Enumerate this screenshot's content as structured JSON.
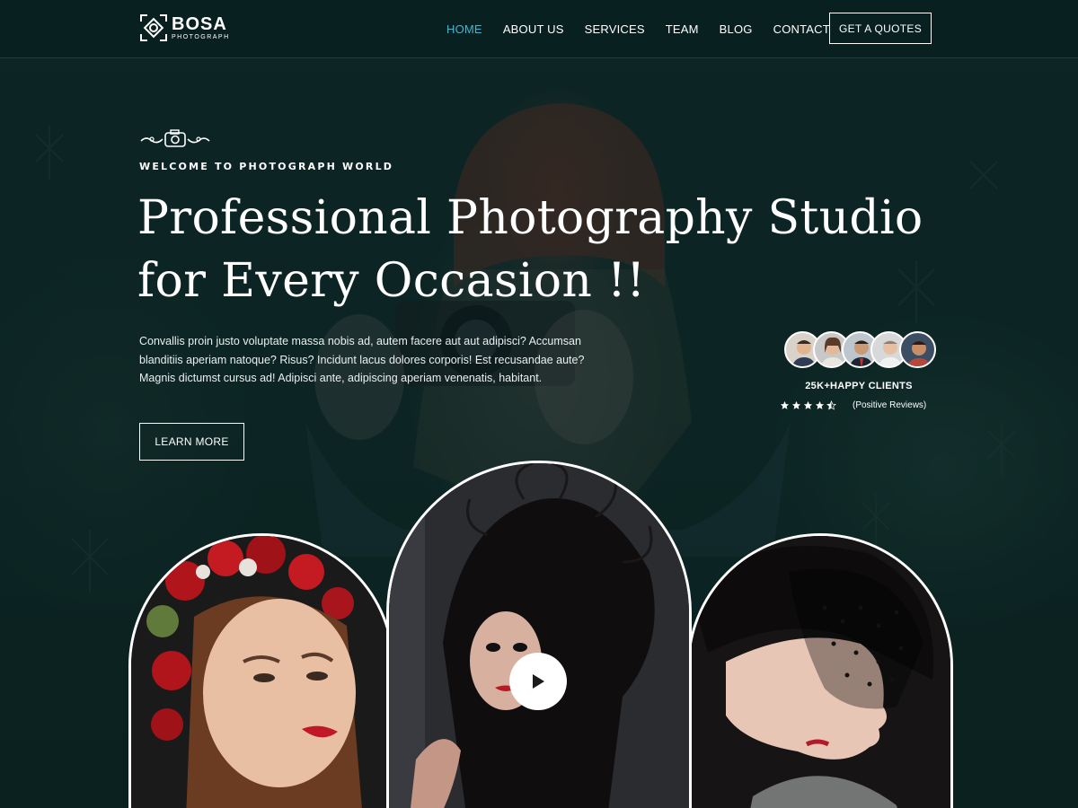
{
  "brand": {
    "name": "BOSA",
    "tagline": "PHOTOGRAPH"
  },
  "nav": {
    "items": [
      {
        "label": "HOME",
        "active": true
      },
      {
        "label": "ABOUT US",
        "active": false
      },
      {
        "label": "SERVICES",
        "active": false
      },
      {
        "label": "TEAM",
        "active": false
      },
      {
        "label": "BLOG",
        "active": false
      },
      {
        "label": "CONTACT",
        "active": false
      }
    ],
    "cta_label": "GET A QUOTES"
  },
  "hero": {
    "eyebrow": "WELCOME TO PHOTOGRAPH WORLD",
    "title_line1": "Professional Photography Studio",
    "title_line2": "for Every Occasion !!",
    "description": "Convallis proin justo voluptate massa nobis ad, autem facere aut aut adipisci? Accumsan blanditiis aperiam natoque? Risus? Incidunt lacus dolores corporis! Est recusandae aute? Magnis dictumst cursus ad! Adipisci ante, adipiscing aperiam venenatis, habitant.",
    "button_label": "LEARN MORE"
  },
  "clients": {
    "count_label": "25K+HAPPY CLIENTS",
    "rating": 4.5,
    "rating_max": 5,
    "reviews_label": "(Positive Reviews)"
  },
  "gallery": {
    "video_icon": "play-icon"
  },
  "colors": {
    "accent": "#4fb0c6",
    "background": "#0d2524",
    "text": "#ffffff"
  }
}
